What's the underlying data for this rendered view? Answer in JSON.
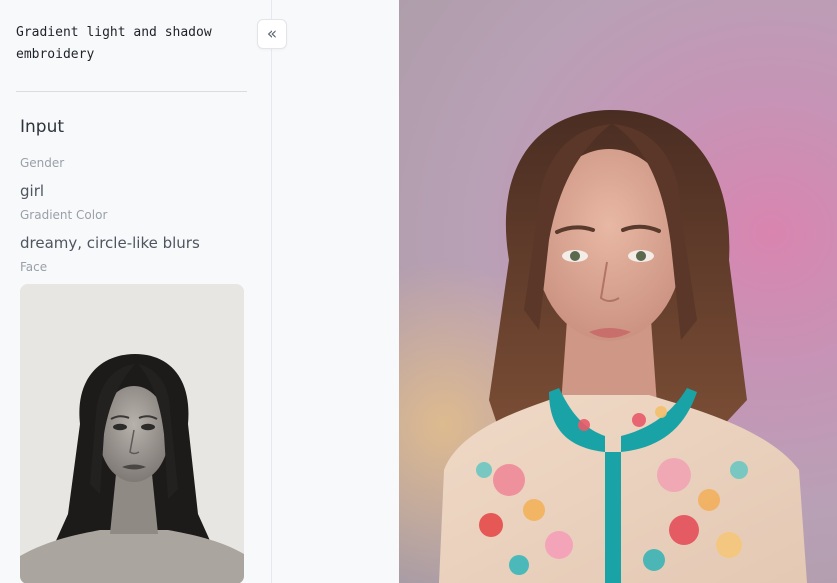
{
  "sidebar": {
    "title": "Gradient light and shadow embroidery",
    "input_title": "Input",
    "fields": [
      {
        "label": "Gender",
        "value": "girl"
      },
      {
        "label": "Gradient Color",
        "value": "dreamy, circle-like blurs"
      },
      {
        "label": "Face"
      }
    ]
  },
  "collapse_icon": "double-chevron-left-icon",
  "colors": {
    "background": "#f8f9fb",
    "text_primary": "#2f343b",
    "text_label": "#9aa0a8"
  }
}
